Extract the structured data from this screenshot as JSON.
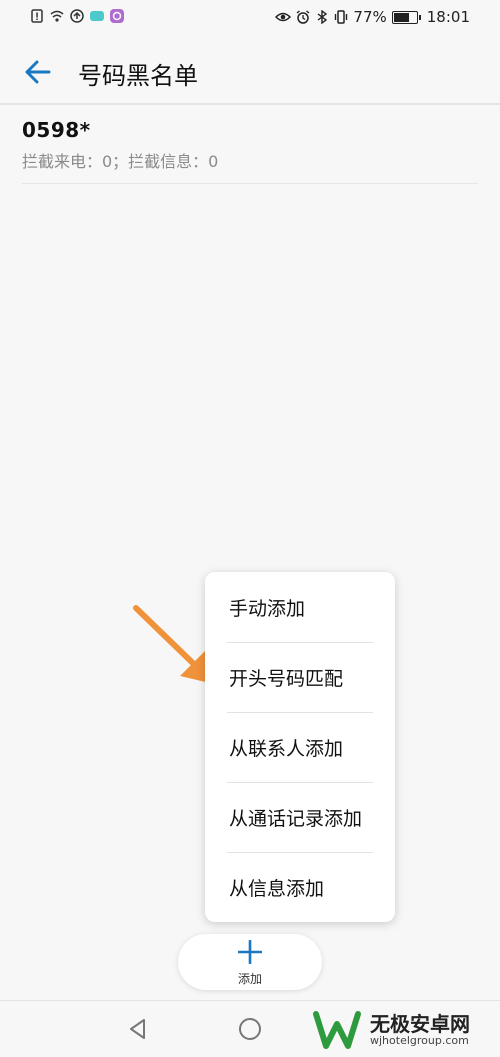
{
  "status_bar": {
    "battery_percent": "77%",
    "battery_level": 0.77,
    "time": "18:01",
    "left_icons": [
      "sim-alert-icon",
      "wifi-icon",
      "sync-icon",
      "app-badge-icon",
      "app-icon"
    ],
    "right_icons": [
      "eye-icon",
      "alarm-icon",
      "bluetooth-icon",
      "vibrate-icon"
    ]
  },
  "header": {
    "title": "号码黑名单"
  },
  "list": [
    {
      "number": "0598*",
      "stats": "拦截来电：0；拦截信息：0"
    }
  ],
  "menu": {
    "items": [
      "手动添加",
      "开头号码匹配",
      "从联系人添加",
      "从通话记录添加",
      "从信息添加"
    ]
  },
  "add_button": {
    "label": "添加"
  },
  "watermark": {
    "brand": "无极安卓网",
    "url": "wjhotelgroup.com"
  },
  "colors": {
    "accent": "#1a78c2",
    "arrow": "#f0923a",
    "background": "#f7f7f7"
  }
}
